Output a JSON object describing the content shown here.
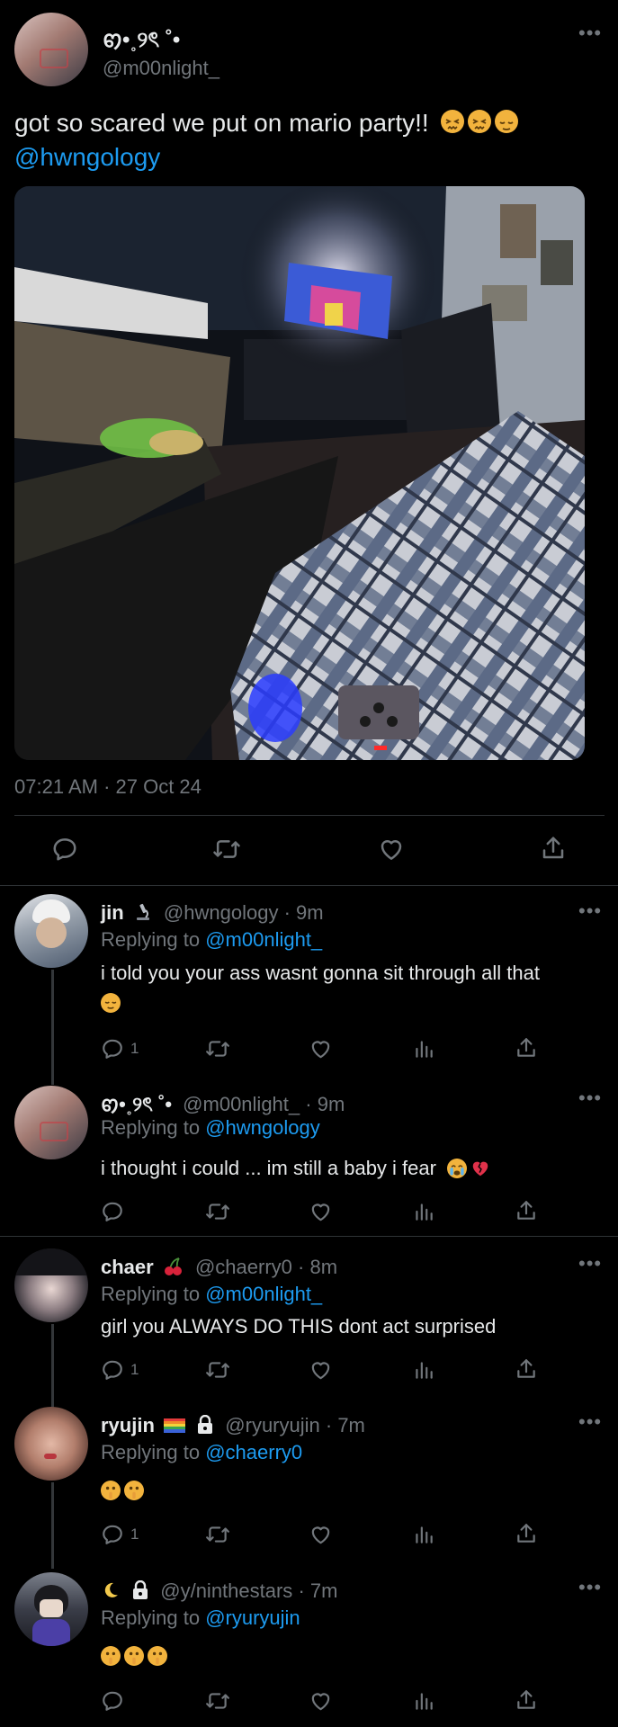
{
  "main_tweet": {
    "display_name": "ꩅ•˳୨ৎ ˚•",
    "handle": "@m00nlight_",
    "text": "got so scared we put on mario party!!",
    "mention": "@hwngology",
    "timestamp": "07:21 AM · 27 Oct 24",
    "emoji": [
      "confounded-face",
      "confounded-face",
      "relieved-face"
    ]
  },
  "replies": [
    {
      "display_name": "jin",
      "badge_icon": "microscope-icon",
      "handle": "@hwngology",
      "time": "· 9m",
      "replying_label": "Replying to",
      "replying_to": "@m00nlight_",
      "text": "i told you your ass wasnt gonna sit through all that",
      "emoji": [
        "relieved-face"
      ],
      "reply_count": "1"
    },
    {
      "display_name": "ꩅ•˳୨ৎ ˚•",
      "handle": "@m00nlight_",
      "time": "· 9m",
      "replying_label": "Replying to",
      "replying_to": "@hwngology",
      "text": "i thought i could ... im still a baby i fear",
      "emoji": [
        "crying-face",
        "broken-heart"
      ],
      "reply_count": ""
    },
    {
      "display_name": "chaer",
      "badge_icon": "cherries-icon",
      "handle": "@chaerry0",
      "time": "· 8m",
      "replying_label": "Replying to",
      "replying_to": "@m00nlight_",
      "text": "girl you ALWAYS DO THIS dont act surprised",
      "emoji": [],
      "reply_count": "1"
    },
    {
      "display_name": "ryujin",
      "badge_icon": "rainbow-flag-icon",
      "handle": "@ryuryujin",
      "time": "· 7m",
      "replying_label": "Replying to",
      "replying_to": "@chaerry0",
      "text": "",
      "emoji": [
        "shushing-face",
        "shushing-face"
      ],
      "reply_count": "1"
    },
    {
      "display_name": "",
      "badge_icon": "crescent-moon-icon",
      "handle": "@y/ninthestars",
      "time": "· 7m",
      "replying_label": "Replying to",
      "replying_to": "@ryuryujin",
      "text": "",
      "emoji": [
        "shushing-face",
        "shushing-face",
        "shushing-face"
      ],
      "reply_count": ""
    }
  ],
  "colors": {
    "background": "#000000",
    "text": "#e7e9ea",
    "muted": "#71767b",
    "link": "#1d9bf0",
    "divider": "#2f3336"
  }
}
